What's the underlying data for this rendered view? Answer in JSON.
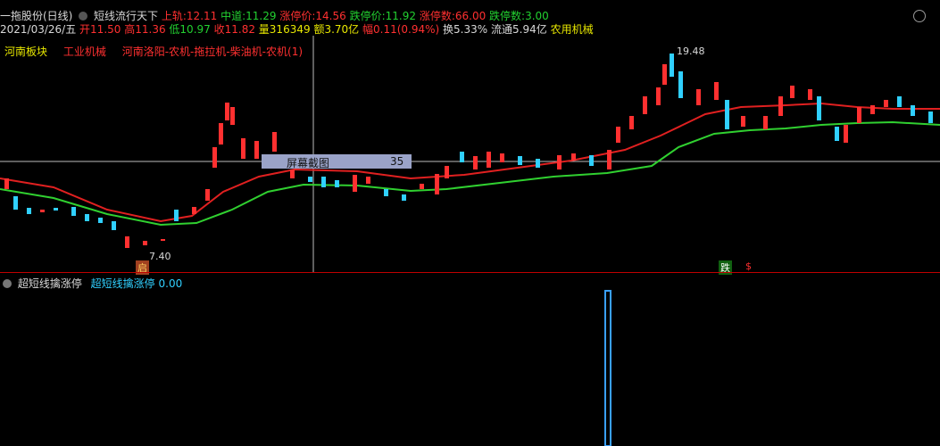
{
  "header": {
    "stock_name": "一拖股份(日线)",
    "strategy": "短线流行天下",
    "upper_label": "上轨:",
    "upper_value": "12.11",
    "mid_label": "中道:",
    "mid_value": "11.29",
    "limitup_price_label": "涨停价:",
    "limitup_price_value": "14.56",
    "limitdown_price_label": "跌停价:",
    "limitdown_price_value": "11.92",
    "limitup_count_label": "涨停数:",
    "limitup_count_value": "66.00",
    "limitdown_count_label": "跌停数:",
    "limitdown_count_value": "3.00"
  },
  "quote": {
    "date": "2021/03/26/五",
    "open": "开11.50",
    "high": "高11.36",
    "low": "低10.97",
    "close": "收11.82",
    "volume": "量316349",
    "amount": "额3.70亿",
    "change": "幅0.11(0.94%)",
    "turnover": "换5.33%",
    "float_cap": "流通5.94亿",
    "industry": "农用机械"
  },
  "sectors": {
    "s1": "河南板块",
    "s2": "工业机械",
    "s3": "河南洛阳-农机-拖拉机-柴油机-农机(1)"
  },
  "annotations": {
    "high_mark": "19.48",
    "low_mark": "7.40",
    "note_low": "启",
    "note_mid": "跌",
    "note_dollar": "$"
  },
  "popup": {
    "title": "屏幕截图",
    "value": "35"
  },
  "sub_indicator": {
    "name": "超短线擒涨停",
    "series_name": "超短线擒涨停",
    "value": "0.00"
  },
  "colors": {
    "up": "#ff3030",
    "down": "#30d0ff",
    "upper_band": "#e02020",
    "mid_band": "#30d030",
    "indicator": "#3aa0ff"
  }
}
